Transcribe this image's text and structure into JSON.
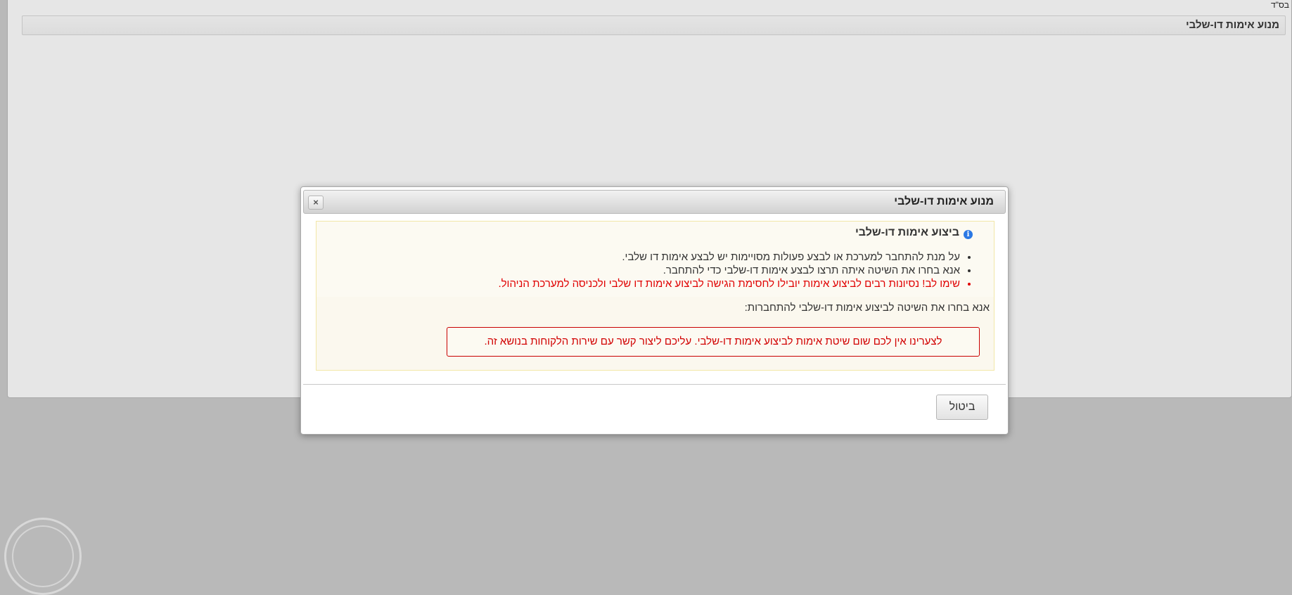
{
  "page": {
    "top_corner_text": "בס\"ד",
    "header_title": "מנוע אימות דו-שלבי"
  },
  "dialog": {
    "title": "מנוע אימות דו-שלבי",
    "close_symbol": "×",
    "info": {
      "heading": "ביצוע אימות דו-שלבי",
      "icon_glyph": "i",
      "notes": [
        "על מנת להתחבר למערכת או לבצע פעולות מסויימות יש לבצע אימות דו שלבי.",
        "אנא בחרו את השיטה איתה תרצו לבצע אימות דו-שלבי כדי להתחבר.",
        "שימו לב! נסיונות רבים לביצוע אימות יובילו לחסימת הגישה לביצוע אימות דו שלבי ולכניסה למערכת הניהול."
      ]
    },
    "choose_method_label": "אנא בחרו את השיטה לביצוע אימות דו-שלבי להתחברות:",
    "error_message": "לצערינו אין לכם שום שיטת אימות לביצוע אימות דו-שלבי. עליכם ליצור קשר עם שירות הלקוחות בנושא זה.",
    "cancel_label": "ביטול"
  },
  "colors": {
    "warning": "#e00000",
    "error_border": "#c90000",
    "info_icon": "#2b78e4",
    "overlay": "#b9b9b9"
  },
  "icons": [
    "info-icon",
    "close-icon",
    "watermark-stamp"
  ]
}
